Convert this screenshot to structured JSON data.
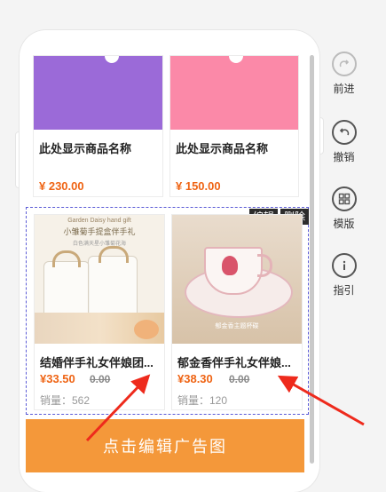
{
  "products_top": [
    {
      "name": "此处显示商品名称",
      "price": "¥ 230.00",
      "color": "#9b6ad8"
    },
    {
      "name": "此处显示商品名称",
      "price": "¥ 150.00",
      "color": "#fb89a8"
    }
  ],
  "products_selected": [
    {
      "name": "结婚伴手礼女伴娘团...",
      "price": "¥33.50",
      "orig": "0.00",
      "sales": "销量：562",
      "img_title": "Garden Daisy hand gift",
      "img_subtitle": "小雏菊手提盒伴手礼",
      "img_caption": "白色满天星小雏菊花海"
    },
    {
      "name": "郁金香伴手礼女伴娘...",
      "price": "¥38.30",
      "orig": "0.00",
      "sales": "销量：120",
      "img_caption": "郁金香主题杯碟"
    }
  ],
  "toolbar": {
    "edit": "编辑",
    "delete": "删除"
  },
  "ad_banner": "点击编辑广告图",
  "right_actions": [
    {
      "label": "前进",
      "icon": "redo-icon"
    },
    {
      "label": "撤销",
      "icon": "undo-icon"
    },
    {
      "label": "模版",
      "icon": "template-icon"
    },
    {
      "label": "指引",
      "icon": "info-icon"
    }
  ],
  "colors": {
    "accent": "#ef6414",
    "selection": "#5b5bd6",
    "arrow": "#ee2a1c",
    "ad": "#f4983a"
  }
}
